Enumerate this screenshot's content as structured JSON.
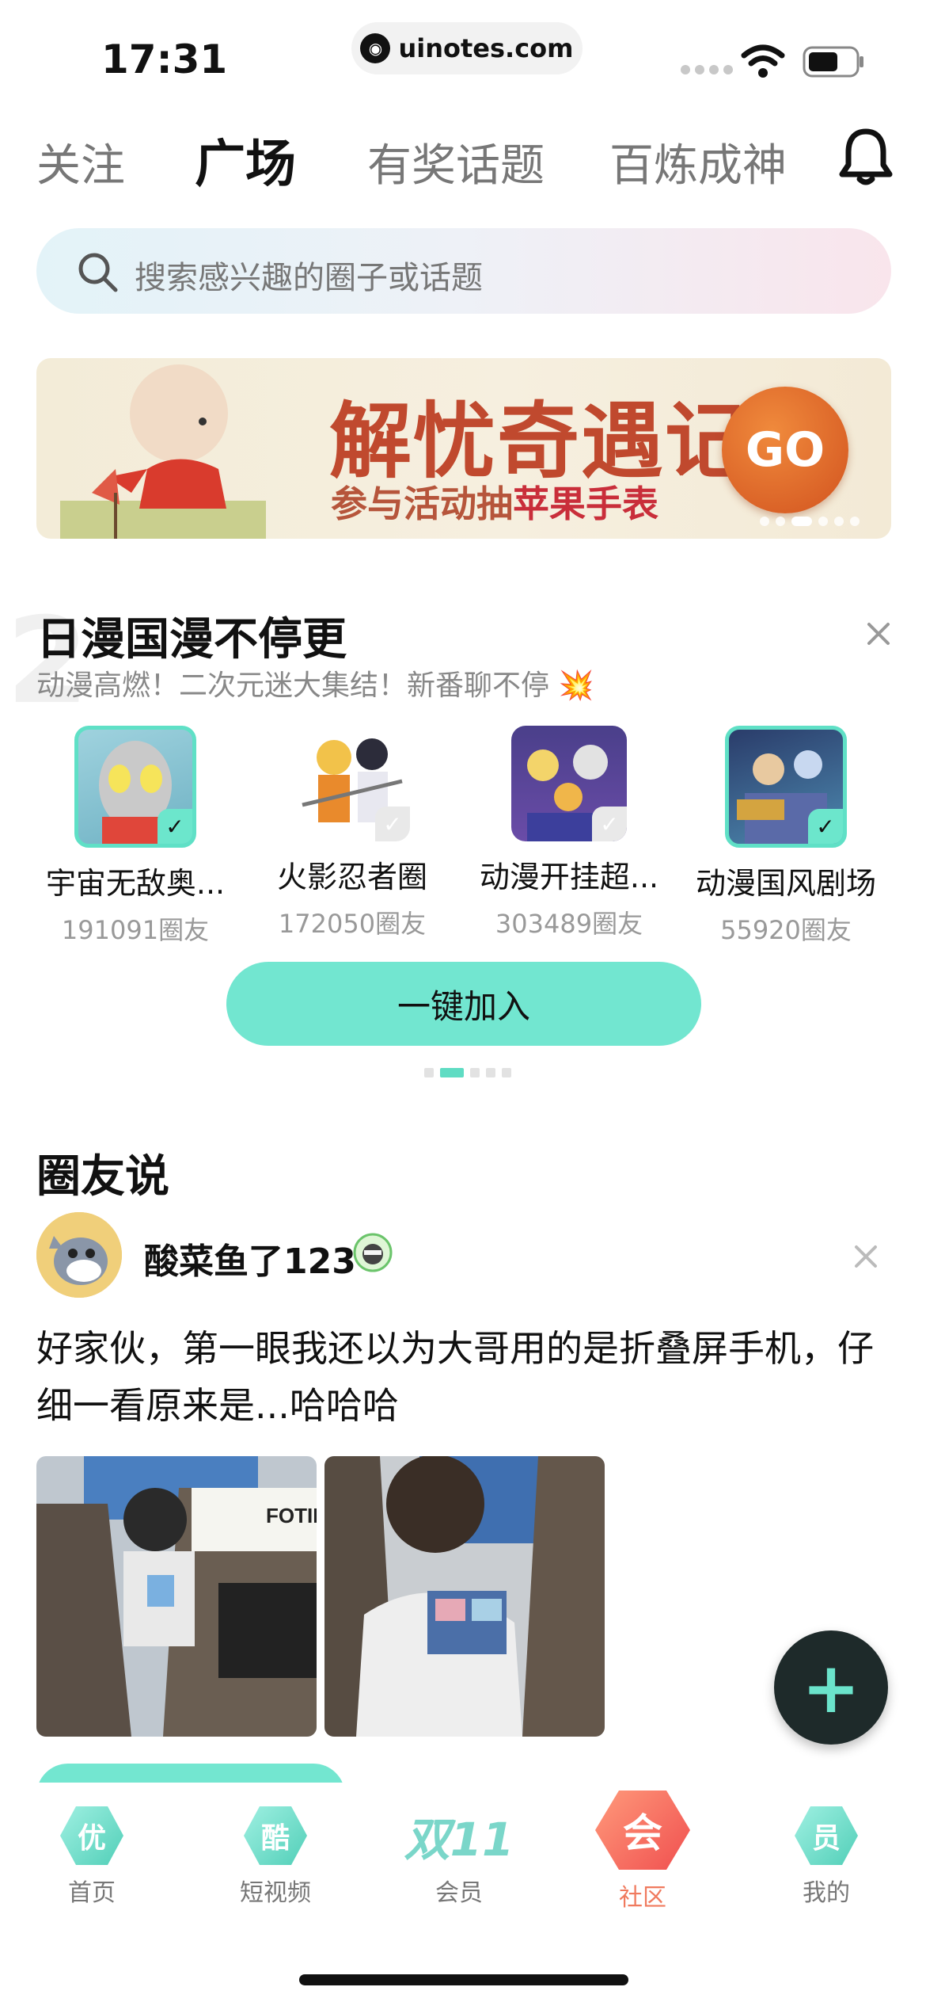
{
  "status_bar": {
    "time": "17:31",
    "url": "uinotes.com"
  },
  "top_tabs": [
    {
      "label": "关注",
      "active": false
    },
    {
      "label": "广场",
      "active": true
    },
    {
      "label": "有奖话题",
      "active": false
    },
    {
      "label": "百炼成神",
      "active": false
    }
  ],
  "search": {
    "placeholder": "搜索感兴趣的圈子或话题"
  },
  "banner": {
    "title": "解忧奇遇记",
    "subtitle_prefix": "参与活动抽",
    "subtitle_highlight": "苹果手表",
    "go_label": "GO"
  },
  "anime_section": {
    "bg_number": "2",
    "title": "日漫国漫不停更",
    "subtitle": "动漫高燃！二次元迷大集结！新番聊不停 💥",
    "circles": [
      {
        "name": "宇宙无敌奥...",
        "count": "191091圈友",
        "joined": true
      },
      {
        "name": "火影忍者圈",
        "count": "172050圈友",
        "joined": false
      },
      {
        "name": "动漫开挂超...",
        "count": "303489圈友",
        "joined": false
      },
      {
        "name": "动漫国风剧场",
        "count": "55920圈友",
        "joined": true
      }
    ],
    "join_all_label": "一键加入"
  },
  "posts_section": {
    "title": "圈友说",
    "post": {
      "username": "酸菜鱼了123",
      "text": "好家伙，第一眼我还以为大哥用的是折叠屏手机，仔细一看原来是...哈哈哈",
      "image_1_caption": "FOTILE"
    }
  },
  "fab_label": "+",
  "bottom_nav": [
    {
      "icon": "优",
      "label": "首页",
      "active": false
    },
    {
      "icon": "酷",
      "label": "短视频",
      "active": false
    },
    {
      "icon": "双11",
      "label": "会员",
      "active": false
    },
    {
      "icon": "会",
      "label": "社区",
      "active": true
    },
    {
      "icon": "员",
      "label": "我的",
      "active": false
    }
  ],
  "colors": {
    "accent": "#72e6d0",
    "active_nav": "#f07a5e",
    "banner_red": "#c0492e"
  }
}
